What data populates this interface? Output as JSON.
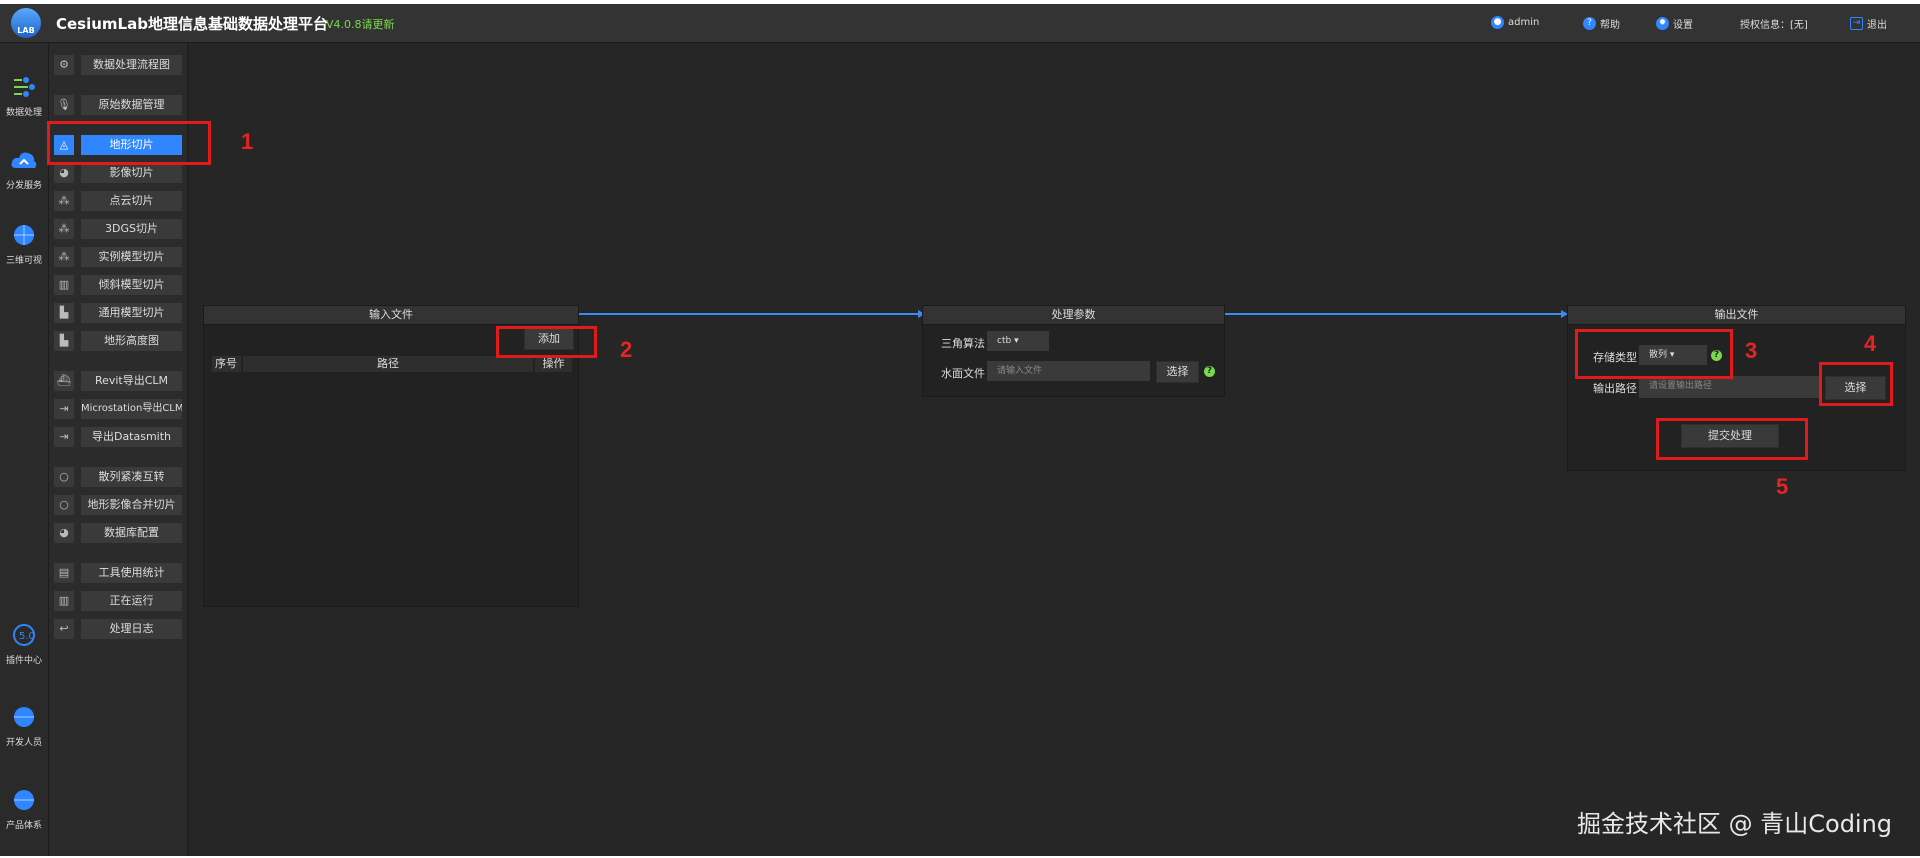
{
  "header": {
    "logo_text": "LAB",
    "title": "CesiumLab地理信息基础数据处理平台",
    "version": "V4.0.8请更新",
    "user": "admin",
    "help": "帮助",
    "settings": "设置",
    "license": "授权信息：[无]",
    "logout": "退出"
  },
  "leftbar": {
    "items": [
      {
        "label": "数据处理",
        "icon": "data-process-icon"
      },
      {
        "label": "分发服务",
        "icon": "cloud-icon"
      },
      {
        "label": "三维可视",
        "icon": "globe-icon"
      },
      {
        "label": "插件中心",
        "icon": "plugin-icon"
      },
      {
        "label": "开发人员",
        "icon": "developer-icon"
      },
      {
        "label": "产品体系",
        "icon": "product-icon"
      }
    ]
  },
  "menu": {
    "items": [
      {
        "label": "数据处理流程图",
        "icon": "gear-icon",
        "glyph": "⚙"
      },
      {
        "label": "原始数据管理",
        "icon": "microphone-icon",
        "glyph": "🎙"
      },
      {
        "label": "地形切片",
        "icon": "terrain-icon",
        "glyph": "◬"
      },
      {
        "label": "影像切片",
        "icon": "image-icon",
        "glyph": "◕"
      },
      {
        "label": "点云切片",
        "icon": "pointcloud-icon",
        "glyph": "⁂"
      },
      {
        "label": "3DGS切片",
        "icon": "3dgs-icon",
        "glyph": "⁂"
      },
      {
        "label": "实例模型切片",
        "icon": "instance-icon",
        "glyph": "⁂"
      },
      {
        "label": "倾斜模型切片",
        "icon": "oblique-icon",
        "glyph": "▥"
      },
      {
        "label": "通用模型切片",
        "icon": "building-icon",
        "glyph": "▙"
      },
      {
        "label": "地形高度图",
        "icon": "heightmap-icon",
        "glyph": "▙"
      },
      {
        "label": "Revit导出CLM",
        "icon": "revit-icon",
        "glyph": "⛴"
      },
      {
        "label": "Microstation导出CLM",
        "icon": "export-icon",
        "glyph": "⇥"
      },
      {
        "label": "导出Datasmith",
        "icon": "export-icon",
        "glyph": "⇥"
      },
      {
        "label": "散列紧凑互转",
        "icon": "convert-icon",
        "glyph": "○"
      },
      {
        "label": "地形影像合并切片",
        "icon": "merge-icon",
        "glyph": "○"
      },
      {
        "label": "数据库配置",
        "icon": "database-icon",
        "glyph": "◕"
      },
      {
        "label": "工具使用统计",
        "icon": "document-icon",
        "glyph": "▤"
      },
      {
        "label": "正在运行",
        "icon": "chart-icon",
        "glyph": "▥"
      },
      {
        "label": "处理日志",
        "icon": "undo-icon",
        "glyph": "↩"
      }
    ]
  },
  "input_panel": {
    "title": "输入文件",
    "add_button": "添加",
    "columns": [
      "序号",
      "路径",
      "操作"
    ]
  },
  "params_panel": {
    "title": "处理参数",
    "triangle_label": "三角算法",
    "triangle_value": "ctb",
    "water_label": "水面文件",
    "water_placeholder": "请输入文件",
    "select_button": "选择",
    "help_glyph": "?"
  },
  "output_panel": {
    "title": "输出文件",
    "storage_label": "存储类型",
    "storage_value": "散列",
    "path_label": "输出路径",
    "path_placeholder": "请设置输出路径",
    "select_button": "选择",
    "submit_button": "提交处理",
    "help_glyph": "?"
  },
  "annotations": [
    "1",
    "2",
    "3",
    "4",
    "5"
  ],
  "watermark": "掘金技术社区 @ 青山Coding",
  "colors": {
    "accent": "#2f86ff",
    "highlight": "#e11b1b",
    "background": "#262626",
    "version": "#7bd84a"
  }
}
